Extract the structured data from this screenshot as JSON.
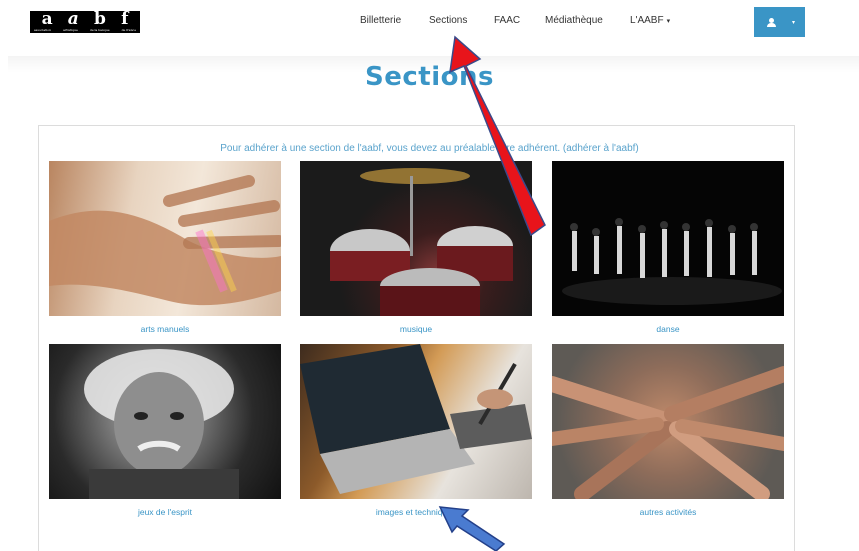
{
  "brand": {
    "logo_letters": [
      "a",
      "a",
      "b",
      "f"
    ],
    "tagline": [
      "association",
      "artistique",
      "de la banque",
      "de france"
    ]
  },
  "nav": {
    "billetterie": "Billetterie",
    "sections": "Sections",
    "faac": "FAAC",
    "mediatheque": "Médiathèque",
    "laabf": "L'AABF",
    "laabf_caret": "▾"
  },
  "user_menu": {
    "icon": "user-icon",
    "caret": "▾",
    "color": "#3a95c6"
  },
  "page": {
    "title": "Sections",
    "intro": "Pour adhérer à une section de l'aabf, vous devez au préalable être adhérent. (adhérer à l'aabf)"
  },
  "sections": [
    {
      "label": "arts manuels",
      "image": "hand-rainbow-photo"
    },
    {
      "label": "musique",
      "image": "drum-kit-photo"
    },
    {
      "label": "danse",
      "image": "dancers-stage-photo"
    },
    {
      "label": "jeux de l'esprit",
      "image": "einstein-portrait-photo"
    },
    {
      "label": "images et techniques",
      "image": "laptop-tablet-photo"
    },
    {
      "label": "autres activités",
      "image": "stacked-hands-photo"
    }
  ],
  "annotations": {
    "red_arrow_color": "#e8141b",
    "blue_arrow_color": "#4a7bd0"
  }
}
